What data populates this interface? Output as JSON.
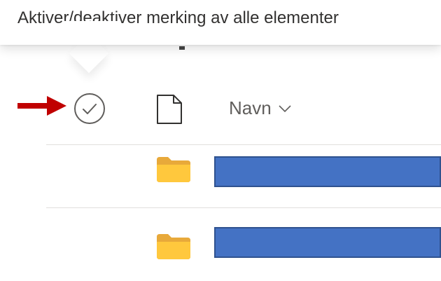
{
  "tooltip": {
    "text": "Aktiver/deaktiver merking av alle elementer"
  },
  "header": {
    "select_all_icon": "check-circle-icon",
    "file_type_icon": "document-icon",
    "name_column_label": "Navn",
    "sort_icon": "chevron-down-icon"
  },
  "annotation": {
    "arrow_color": "#c00000"
  },
  "rows": [
    {
      "icon": "folder-icon",
      "name_redacted": true
    },
    {
      "icon": "folder-icon",
      "name_redacted": true
    }
  ],
  "colors": {
    "folder": "#ffc83d",
    "redaction": "#4472c4",
    "text": "#605e5c",
    "divider": "#e1dfdd"
  }
}
